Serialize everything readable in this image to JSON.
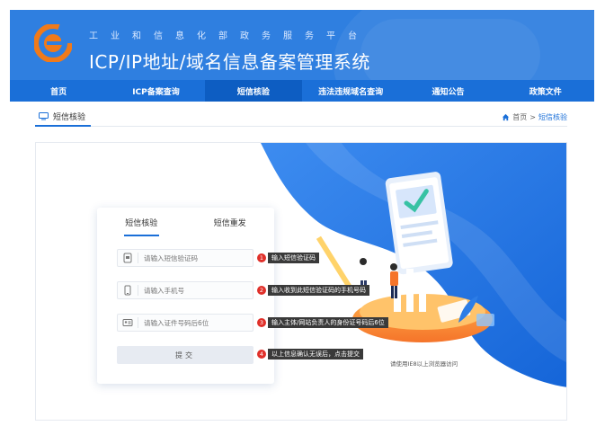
{
  "header": {
    "subtitle": "工业和信息化部政务服务平台",
    "title": "ICP/IP地址/域名信息备案管理系统"
  },
  "nav": {
    "items": [
      {
        "label": "首页"
      },
      {
        "label": "ICP备案查询"
      },
      {
        "label": "短信核验"
      },
      {
        "label": "违法违规域名查询"
      },
      {
        "label": "通知公告"
      },
      {
        "label": "政策文件"
      }
    ],
    "active_index": 2
  },
  "breadcrumb": {
    "tab_label": "短信核验",
    "home": "首页",
    "separator": ">",
    "current": "短信核验"
  },
  "form": {
    "tabs": [
      "短信核验",
      "短信重发"
    ],
    "sms_code_placeholder": "请输入短信验证码",
    "phone_placeholder": "请输入手机号",
    "id_placeholder": "请输入证件号码后6位",
    "submit_label": "提交"
  },
  "callouts": [
    {
      "num": "1",
      "text": "输入短信验证码"
    },
    {
      "num": "2",
      "text": "输入收到此短信验证码的手机号码"
    },
    {
      "num": "3",
      "text": "输入主体/网站负责人的身份证号码后6位"
    },
    {
      "num": "4",
      "text": "以上信息确认无误后，点击提交"
    }
  ],
  "hint": "请使用IE8以上浏览器访问",
  "colors": {
    "header_blue": "#2f7fe0",
    "nav_blue": "#1a6fd8",
    "nav_active": "#0d5dc2",
    "callout_red": "#e0302a"
  }
}
